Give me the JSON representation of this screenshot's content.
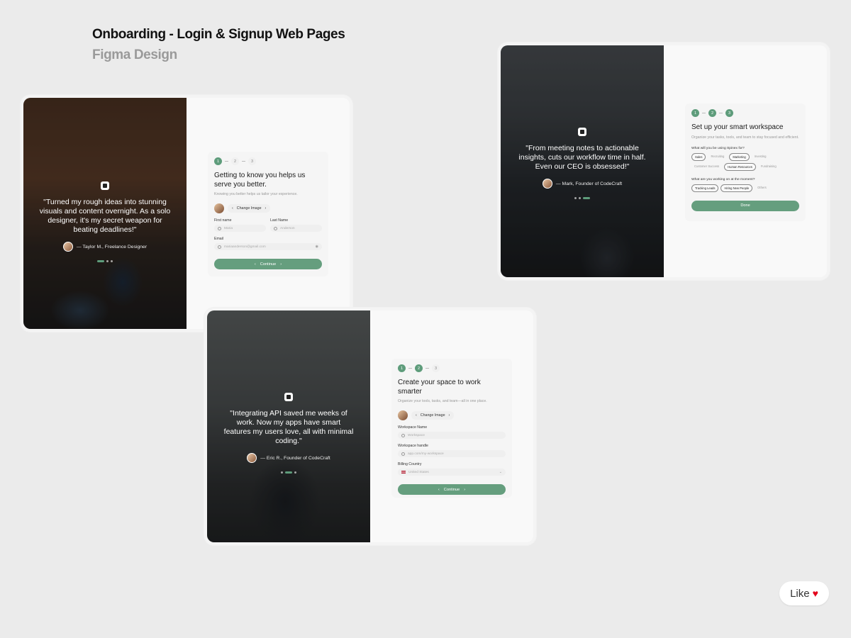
{
  "header": {
    "title": "Onboarding - Login & Signup Web Pages",
    "subtitle": "Figma Design"
  },
  "screen1": {
    "quote": "\"Turned my rough ideas into stunning visuals and content overnight. As a solo designer, it's my secret weapon for beating deadlines!\"",
    "author": "— Taylor M., Freelance Designer",
    "steps": [
      "1",
      "2",
      "3"
    ],
    "title": "Getting to know you helps us serve you better.",
    "subtitle": "Knowing you better helps us tailor your experience.",
    "change_image": "Change Image",
    "first_name_label": "First name",
    "first_name_placeholder": "Maria",
    "last_name_label": "Last Name",
    "last_name_placeholder": "Anderson",
    "email_label": "Email",
    "email_placeholder": "mariaanderson@gmail.com",
    "button": "Continue"
  },
  "screen2": {
    "quote": "\"From meeting notes to actionable insights, cuts our workflow time in half. Even our CEO is obsessed!\"",
    "author": "— Mark, Founder of CodeCraft",
    "steps": [
      "1",
      "2",
      "3"
    ],
    "title": "Set up your smart workspace",
    "subtitle": "Organize your tasks, tools, and team to stay focused and efficient.",
    "q1": "What will you be using Spinex for?",
    "q1_options": [
      {
        "label": "Sales",
        "selected": true
      },
      {
        "label": "Recruiting",
        "selected": false
      },
      {
        "label": "Marketing",
        "selected": true
      },
      {
        "label": "Investing",
        "selected": false
      },
      {
        "label": "Customer Success",
        "selected": false
      },
      {
        "label": "Human Resources",
        "selected": true
      },
      {
        "label": "Fundraising",
        "selected": false
      }
    ],
    "q2": "What are you working on at the moment?",
    "q2_options": [
      {
        "label": "Tracking Leads",
        "selected": true
      },
      {
        "label": "Hiring New People",
        "selected": true
      },
      {
        "label": "Others",
        "selected": false
      }
    ],
    "button": "Done"
  },
  "screen3": {
    "quote": "\"Integrating API saved me weeks of work. Now my apps have smart features my users love, all with minimal coding.\"",
    "author": "— Eric R., Founder of CodeCraft",
    "steps": [
      "1",
      "2",
      "3"
    ],
    "title": "Create your space to work smarter",
    "subtitle": "Organize your tools, tasks, and team—all in one place.",
    "change_image": "Change Image",
    "workspace_name_label": "Workspace Name",
    "workspace_name_placeholder": "Workspace",
    "workspace_handle_label": "Workspace handle",
    "workspace_handle_placeholder": "app.com/my-workspace",
    "billing_country_label": "Billing Country",
    "billing_country_value": "United States",
    "button": "Continue"
  },
  "like": {
    "label": "Like"
  },
  "colors": {
    "accent": "#659e7e",
    "background": "#ebebeb"
  }
}
